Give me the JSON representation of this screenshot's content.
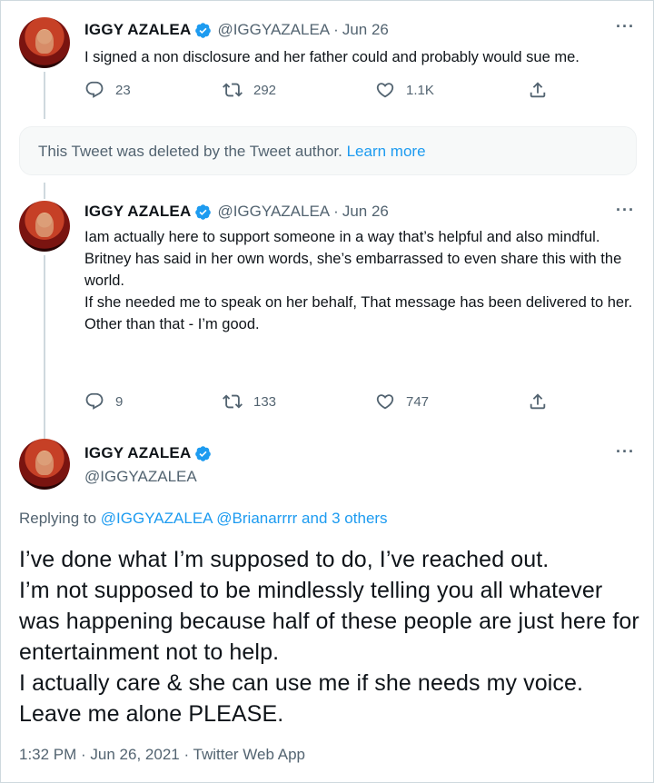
{
  "tweets": [
    {
      "name": "IGGY AZALEA",
      "handle": "@IGGYAZALEA",
      "date": "Jun 26",
      "text": [
        "I signed a non disclosure and her father could and probably would sue me."
      ],
      "replies": "23",
      "retweets": "292",
      "likes": "1.1K"
    },
    {
      "name": "IGGY AZALEA",
      "handle": "@IGGYAZALEA",
      "date": "Jun 26",
      "text": [
        "Iam actually here to support someone in a way that’s helpful and also mindful.",
        "Britney has said in her own words, she’s embarrassed to even share this with the world.",
        "If she needed me to speak on her behalf, That message has been delivered to her.",
        "Other than that - I’m good."
      ],
      "replies": "9",
      "retweets": "133",
      "likes": "747"
    }
  ],
  "deleted": {
    "text": "This Tweet was deleted by the Tweet author.",
    "link": "Learn more"
  },
  "main_tweet": {
    "name": "IGGY AZALEA",
    "handle": "@IGGYAZALEA",
    "replying_prefix": "Replying to",
    "replying_link": "@IGGYAZALEA @Brianarrrr and 3 others",
    "text": [
      "I’ve done what I’m supposed to do, I’ve reached out.",
      "I’m not supposed to be mindlessly telling you all whatever was happening because half of these people are just here for entertainment not to help.",
      "I actually care & she can use me if she needs my voice.",
      "Leave me alone PLEASE."
    ],
    "timestamp": "1:32 PM · Jun 26, 2021 · Twitter Web App"
  },
  "ui": {
    "dot": "·",
    "more": "···",
    "verified_color": "#1d9bf0",
    "icons": [
      "reply-icon",
      "retweet-icon",
      "like-icon",
      "share-icon",
      "verified-icon",
      "more-icon"
    ]
  }
}
